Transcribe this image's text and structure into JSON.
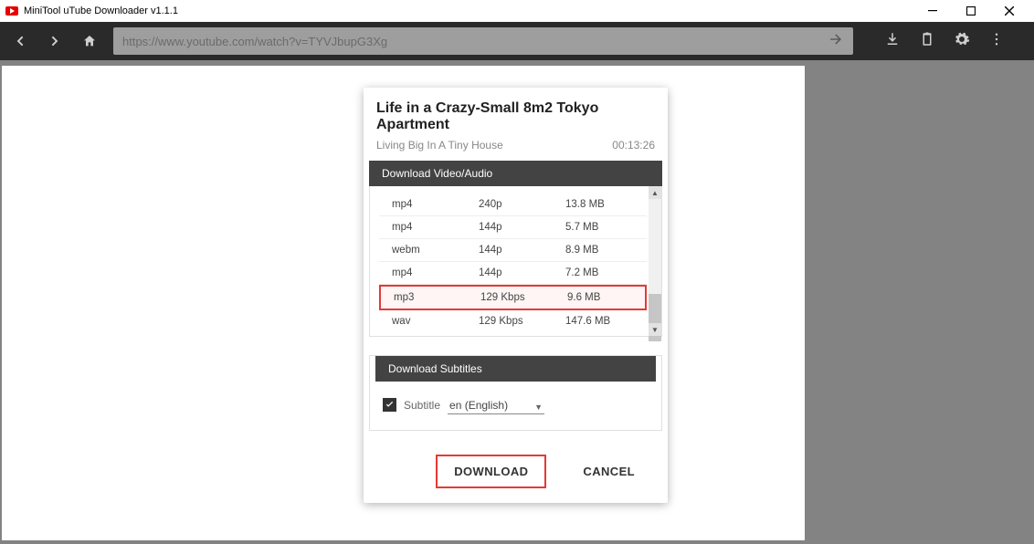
{
  "app": {
    "title": "MiniTool uTube Downloader v1.1.1"
  },
  "url": "https://www.youtube.com/watch?v=TYVJbupG3Xg",
  "dialog": {
    "title": "Life in a Crazy-Small 8m2 Tokyo Apartment",
    "channel": "Living Big In A Tiny House",
    "duration": "00:13:26",
    "section_video": "Download Video/Audio",
    "section_subs": "Download Subtitles",
    "subtitle_label": "Subtitle",
    "subtitle_lang": "en (English)",
    "download_label": "DOWNLOAD",
    "cancel_label": "CANCEL"
  },
  "formats": [
    {
      "fmt": "mp4",
      "quality": "240p",
      "size": "13.8 MB",
      "selected": false
    },
    {
      "fmt": "mp4",
      "quality": "144p",
      "size": "5.7 MB",
      "selected": false
    },
    {
      "fmt": "webm",
      "quality": "144p",
      "size": "8.9 MB",
      "selected": false
    },
    {
      "fmt": "mp4",
      "quality": "144p",
      "size": "7.2 MB",
      "selected": false
    },
    {
      "fmt": "mp3",
      "quality": "129 Kbps",
      "size": "9.6 MB",
      "selected": true
    },
    {
      "fmt": "wav",
      "quality": "129 Kbps",
      "size": "147.6 MB",
      "selected": false
    }
  ]
}
